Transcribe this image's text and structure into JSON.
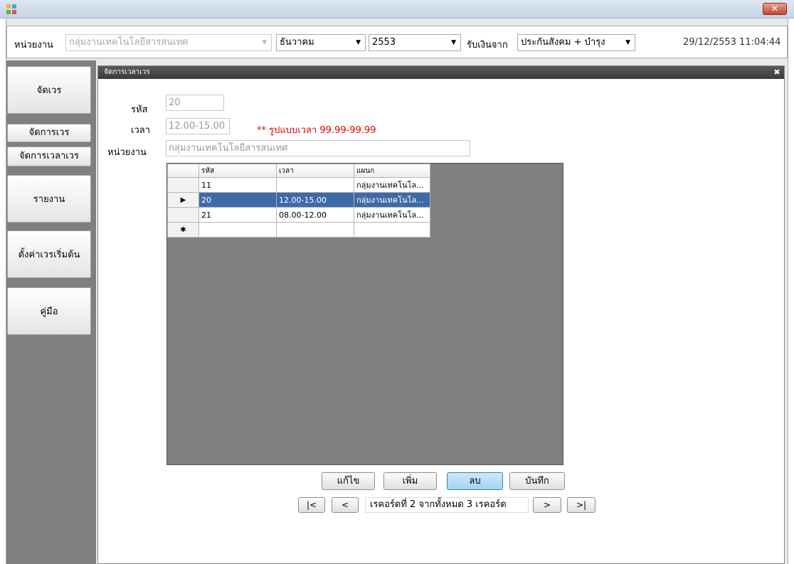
{
  "window": {
    "close_icon": "✕"
  },
  "toolbar": {
    "unit_label": "หน่วยงาน",
    "unit_value": "กลุ่มงานเทคโนโลยีสารสนเทศ",
    "month_value": "ธันวาคม",
    "year_value": "2553",
    "payment_label": "รับเงินจาก",
    "payment_value": "ประกันสังคม + บำรุง",
    "datetime": "29/12/2553 11:04:44"
  },
  "sidebar": {
    "items": [
      {
        "label": "จัดเวร"
      },
      {
        "label": "จัดการเวร"
      },
      {
        "label": "จัดการเวลาเวร"
      },
      {
        "label": "รายงาน"
      },
      {
        "label": "ตั้งค่าเวรเริ่มต้น"
      },
      {
        "label": "คู่มือ"
      }
    ]
  },
  "panel": {
    "title": "จัดการเวลาเวร",
    "close_icon": "✖"
  },
  "form": {
    "code_label": "รหัส",
    "code_value": "20",
    "time_label": "เวลา",
    "time_value": "12.00-15.00",
    "time_hint": "** รูปแบบเวลา 99.99-99.99",
    "unit_label": "หน่วยงาน",
    "unit_value": "กลุ่มงานเทคโนโลยีสารสนเทศ"
  },
  "grid": {
    "columns": [
      "รหัส",
      "เวลา",
      "แผนก"
    ],
    "rows": [
      {
        "marker": "",
        "code": "11",
        "time": "",
        "dept": "กลุ่มงานเทคโนโล..."
      },
      {
        "marker": "▶",
        "code": "20",
        "time": "12.00-15.00",
        "dept": "กลุ่มงานเทคโนโล..."
      },
      {
        "marker": "",
        "code": "21",
        "time": "08.00-12.00",
        "dept": "กลุ่มงานเทคโนโล..."
      },
      {
        "marker": "✱",
        "code": "",
        "time": "",
        "dept": ""
      }
    ]
  },
  "actions": {
    "edit": "แก้ไข",
    "add": "เพิ่ม",
    "delete": "ลบ",
    "save": "บันทึก"
  },
  "navigator": {
    "first": "|<",
    "prev": "<",
    "record_text": "เรคอร์ดที่ 2 จากทั้งหมด 3 เรคอร์ด",
    "next": ">",
    "last": ">|"
  }
}
